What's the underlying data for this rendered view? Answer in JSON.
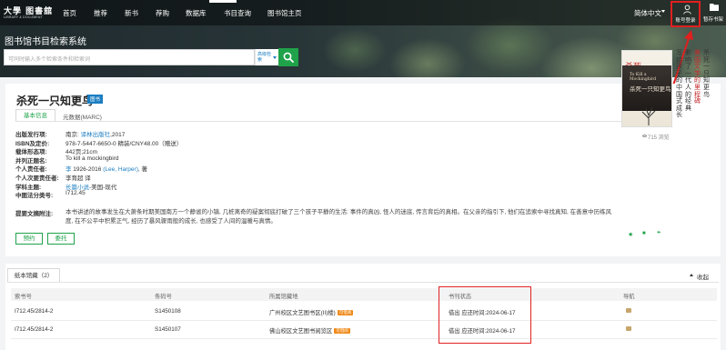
{
  "header": {
    "logo_text": "大學 图書舘",
    "logo_subtitle": "LIBRARY & DOCUMENT",
    "nav_items": [
      {
        "label": "首页"
      },
      {
        "label": "推荐"
      },
      {
        "label": "新书"
      },
      {
        "label": "荐购"
      },
      {
        "label": "数据库"
      },
      {
        "label": "书目查询"
      },
      {
        "label": "图书馆主页"
      }
    ],
    "language": "简体中文",
    "login_label": "账号登录",
    "shelf_label": "暂存书架",
    "system_title": "图书馆书目检索系统",
    "search_placeholder": "可同时输入多个检索条件和检索词",
    "advanced_label": "高级检索"
  },
  "book": {
    "title": "杀死一只知更鸟",
    "type_badge": "图书",
    "tabs": [
      "基本信息",
      "元数据(MARC)"
    ],
    "fields": [
      {
        "label": "出版发行项:",
        "parts": [
          {
            "t": "南京: "
          },
          {
            "t": "译林出版社",
            "link": true
          },
          {
            "t": ",2017"
          }
        ]
      },
      {
        "label": "ISBN及定价:",
        "parts": [
          {
            "t": "978-7-5447-6650-0 精装/CNY48.00（赠送）"
          }
        ]
      },
      {
        "label": "载体形态项:",
        "parts": [
          {
            "t": "442页;21cm"
          }
        ]
      },
      {
        "label": "并列正题名:",
        "parts": [
          {
            "t": "To kill a mockingbird"
          }
        ]
      },
      {
        "label": "个人责任者:",
        "parts": [
          {
            "t": "李",
            "link": true
          },
          {
            "t": " 1926-2016 "
          },
          {
            "t": "(Lee, Harper)",
            "link": true
          },
          {
            "t": ", 著"
          }
        ]
      },
      {
        "label": "个人次要责任者:",
        "parts": [
          {
            "t": "李育超 译"
          }
        ]
      },
      {
        "label": "学科主题:",
        "parts": [
          {
            "t": "长篇小说",
            "link": true
          },
          {
            "t": "-美国-现代"
          }
        ]
      },
      {
        "label": "中图法分类号:",
        "parts": [
          {
            "t": "I712.45"
          }
        ]
      }
    ],
    "summary_label": "提要文摘附注:",
    "summary": "本书讲述的故事发生在大萧条时期美国南方一个静谧的小镇, 几桩离奇的疑案彻底打破了三个孩子平静的生活: 事件的真凶, 怪人的迷底, 传言背后的真相。在父亲的指引下, 他们在追索中寻找真知, 在善意中历练风度, 在不公平中积累正气, 经历了暴风骤雨般的成长, 也感受了人间的温暖与真情。",
    "buttons": {
      "reserve": "预约",
      "entrust": "委托"
    },
    "cover": {
      "title_red": "杀死",
      "title_en": "To Kill a Mockingbird",
      "title_cn": "杀死一只知更鸟"
    },
    "spine_text": [
      "写给孩子的中国式成长",
      "影响了一代人的经典",
      "美国文学的里程碑",
      "杀死一只知更鸟"
    ],
    "views": "715 浏览",
    "action_icons": [
      "★",
      "■",
      "❝"
    ]
  },
  "holdings": {
    "tab_label": "纸本馆藏（2）",
    "collapse_label": "收起",
    "columns": [
      "索书号",
      "条码号",
      "所属馆藏地",
      "书刊状态",
      "导航"
    ],
    "rows": [
      {
        "call_no": "I712.45/2814-2",
        "barcode": "S1450108",
        "location": "广州校区文艺图书区(II)楼)",
        "lend_tag": "可借阅",
        "status": "借出 应还时间:2024-06-17"
      },
      {
        "call_no": "I712.45/2814-2",
        "barcode": "S1450107",
        "location": "佛山校区文艺图书阅览区",
        "lend_tag": "可借阅",
        "status": "借出 应还时间:2024-06-17"
      }
    ]
  },
  "colors": {
    "accent_green": "#1fa24a",
    "link_blue": "#1b7ec2",
    "highlight_red": "#e02020",
    "tag_orange": "#f08a1a"
  }
}
